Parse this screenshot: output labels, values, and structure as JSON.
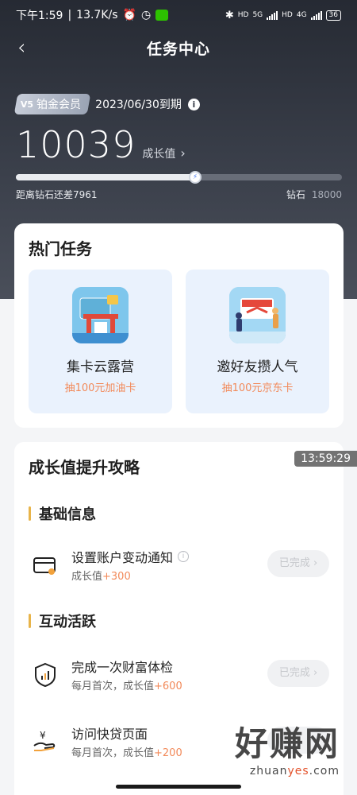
{
  "status": {
    "time": "下午1:59",
    "speed": "13.7K/s",
    "battery": "36",
    "net1": "HD",
    "net2": "5G",
    "net3": "HD",
    "net4": "4G"
  },
  "nav": {
    "back_icon": "chevron-left-icon",
    "title": "任务中心"
  },
  "member": {
    "level": "V5",
    "tier": "铂金会员",
    "expire": "2023/06/30到期",
    "points": "10039",
    "points_label": "成长值",
    "progress_fraction": 0.55,
    "remaining_text": "距离钻石还差7961",
    "target_name": "钻石",
    "target_value": "18000"
  },
  "hot_tasks": {
    "title": "热门任务",
    "items": [
      {
        "name": "集卡云露营",
        "reward": "抽100元加油卡"
      },
      {
        "name": "邀好友攒人气",
        "reward": "抽100元京东卡"
      }
    ]
  },
  "growth": {
    "title": "成长值提升攻略",
    "sections": [
      {
        "title": "基础信息"
      },
      {
        "title": "互动活跃"
      }
    ],
    "tasks": [
      {
        "name": "设置账户变动通知",
        "prefix": "成长值",
        "plus": "+300",
        "button": "已完成 ›"
      },
      {
        "name": "完成一次财富体检",
        "prefix": "每月首次，成长值",
        "plus": "+600",
        "button": "已完成 ›"
      },
      {
        "name": "访问快贷页面",
        "prefix": "每月首次，成长值",
        "plus": "+200",
        "button": ""
      }
    ]
  },
  "overlay_time": "13:59:29",
  "watermark": {
    "text": "好赚网",
    "url_a": "zhuan",
    "url_b": "yes",
    "url_c": ".com"
  },
  "colors": {
    "accent_orange": "#f28a5a",
    "section_bar": "#e8b44a",
    "hero_bg": "#2e323c"
  }
}
